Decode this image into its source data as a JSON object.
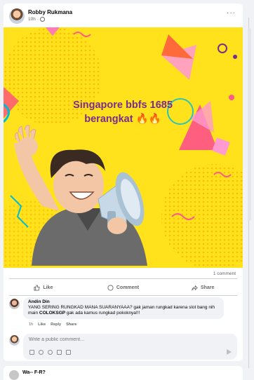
{
  "post": {
    "author": "Robby Rukmana",
    "time": "10h",
    "dot": "·",
    "more": "···"
  },
  "banner": {
    "line1": "Singapore bbfs 1685",
    "line2": "berangkat",
    "emoji": "🔥🔥"
  },
  "stats": {
    "comments": "1 comment"
  },
  "actions": {
    "like": "Like",
    "comment": "Comment",
    "share": "Share"
  },
  "comment": {
    "author": "Andin Din",
    "text_part1": "YANG SERING RUNGKAD MANA SUARANYAAA? gak jaman rungkad karena slot bang nih main ",
    "text_bold": "COLOKSGP",
    "text_part2": " gak ada kamus rungkad pokoknya!!!",
    "time": "1h",
    "like": "Like",
    "reply": "Reply",
    "share": "Share"
  },
  "composer": {
    "placeholder": "Write a public comment…"
  },
  "next_post": {
    "author": "Wa-- F-R?"
  },
  "colors": {
    "banner_bg": "#ffe21b",
    "headline": "#7a2c8d"
  }
}
